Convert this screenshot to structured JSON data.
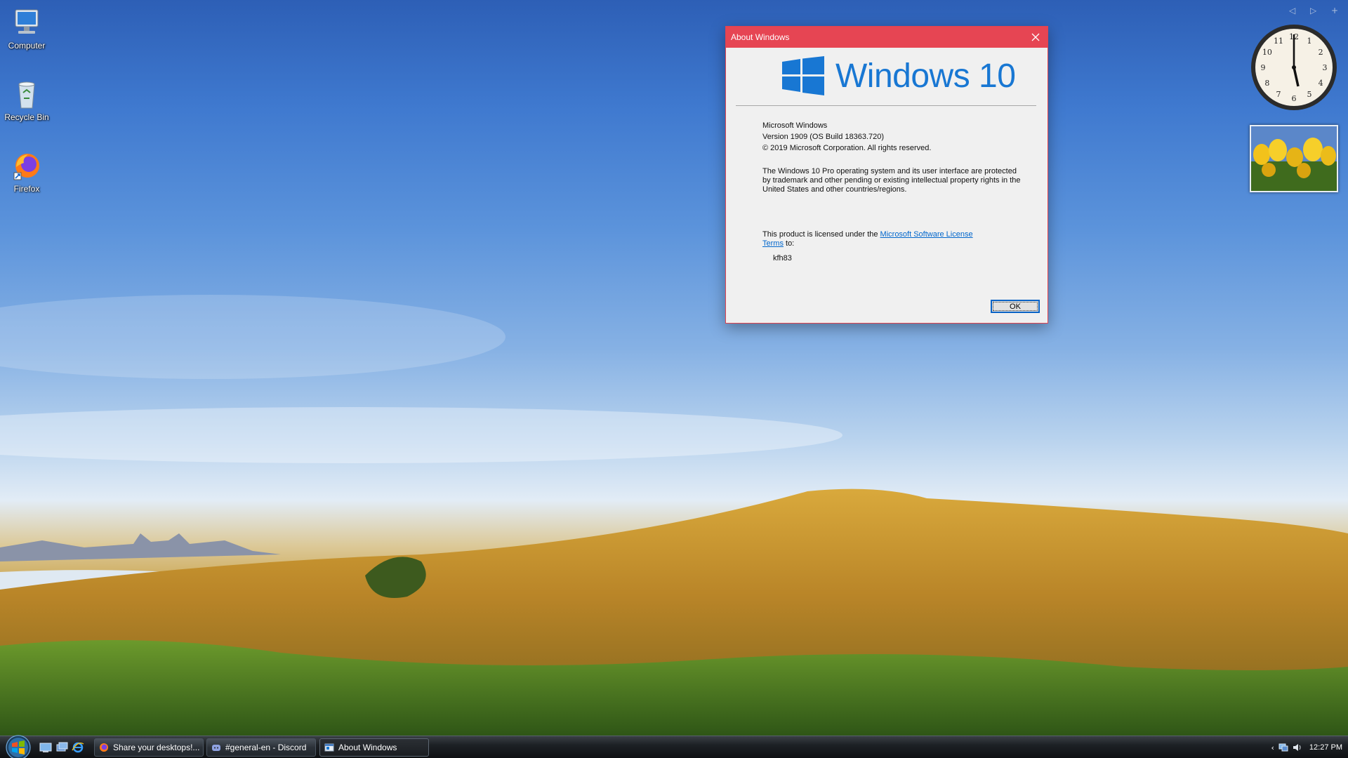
{
  "desktop": {
    "icons": [
      {
        "label": "Computer",
        "icon": "computer-icon"
      },
      {
        "label": "Recycle Bin",
        "icon": "recycle-bin-icon"
      },
      {
        "label": "Firefox",
        "icon": "firefox-icon"
      }
    ],
    "clock_numbers": [
      "12",
      "1",
      "2",
      "3",
      "4",
      "5",
      "6",
      "7",
      "8",
      "9",
      "10",
      "11"
    ]
  },
  "dialog": {
    "title": "About Windows",
    "logo_text": "Windows 10",
    "product_name": "Microsoft Windows",
    "version": "Version 1909 (OS Build 18363.720)",
    "copyright": "© 2019 Microsoft Corporation. All rights reserved.",
    "legal": "The Windows 10 Pro operating system and its user interface are protected by trademark and other pending or existing intellectual property rights in the United States and other countries/regions.",
    "license_prefix": "This product is licensed under the ",
    "license_link": "Microsoft Software License Terms",
    "license_suffix": " to:",
    "licensee": "kfh83",
    "ok_label": "OK"
  },
  "taskbar": {
    "quicklaunch": [
      "show-desktop-icon",
      "switch-windows-icon",
      "internet-explorer-icon"
    ],
    "buttons": [
      {
        "label": "Share your desktops!...",
        "icon": "firefox-icon"
      },
      {
        "label": "#general-en - Discord",
        "icon": "discord-icon"
      },
      {
        "label": "About Windows",
        "icon": "window-icon"
      }
    ],
    "clock": "12:27 PM"
  },
  "colors": {
    "dialog_titlebar": "#e64553",
    "windows_blue": "#1877d3",
    "link": "#0066cc"
  }
}
